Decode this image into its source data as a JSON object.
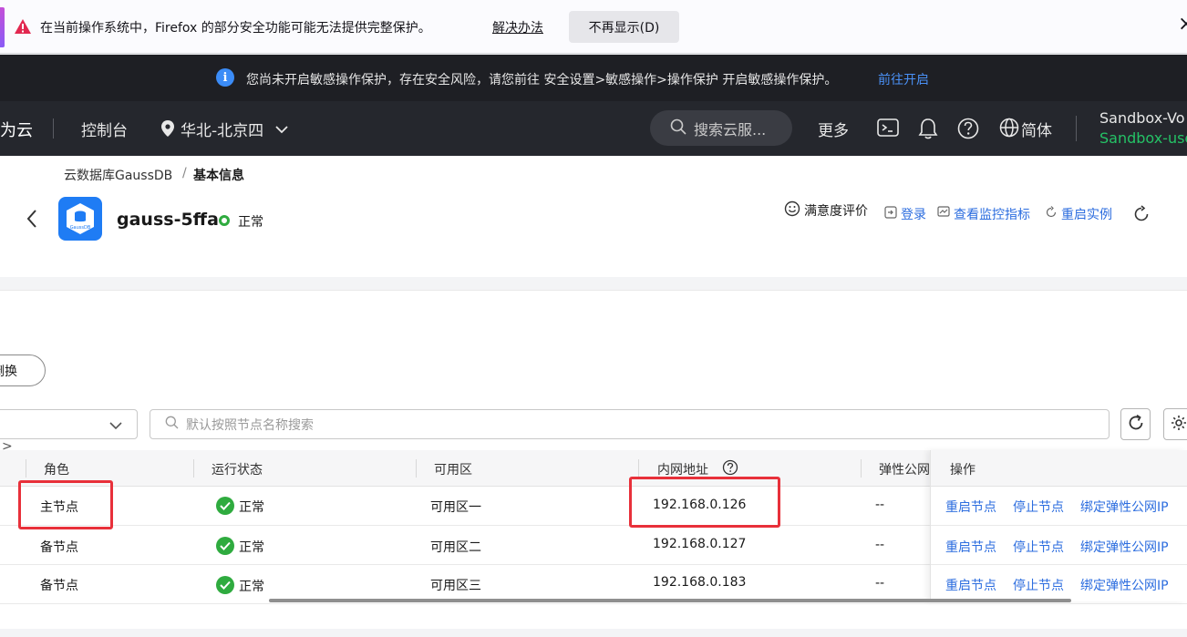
{
  "firefox_bar": {
    "message": "在当前操作系统中，Firefox 的部分安全功能可能无法提供完整保护。",
    "fix_link": "解决办法",
    "dont_show_button": "不再显示(D)",
    "close": "×"
  },
  "notice": {
    "text": "您尚未开启敏感操作保护，存在安全风险，请您前往 安全设置>敏感操作>操作保护 开启敏感操作保护。",
    "link": "前往开启",
    "info_glyph": "i"
  },
  "topnav": {
    "brand": "为云",
    "console": "控制台",
    "region": "华北-北京四",
    "search_placeholder": "搜索云服...",
    "more": "更多",
    "language": "简体",
    "account_line1": "Sandbox-Vo",
    "account_line2": "Sandbox-use"
  },
  "breadcrumb": {
    "parent": "云数据库GaussDB",
    "separator": "/",
    "current": "基本信息"
  },
  "instance": {
    "name": "gauss-5ffa",
    "status": "正常",
    "logo_text": "GaussDB"
  },
  "header_actions": {
    "satisfaction": "满意度评价",
    "login": "登录",
    "monitor": "查看监控指标",
    "restart": "重启实例"
  },
  "toolbar": {
    "switch_button": "倒换",
    "search_placeholder": "默认按照节点名称搜索",
    "expand_glyph": ">"
  },
  "table": {
    "columns": {
      "role": "角色",
      "run_status": "运行状态",
      "az": "可用区",
      "private_ip": "内网地址",
      "eip": "弹性公网",
      "ops": "操作"
    },
    "rows": [
      {
        "role": "主节点",
        "status": "正常",
        "az": "可用区一",
        "ip": "192.168.0.126",
        "eip": "--",
        "op1": "重启节点",
        "op2": "停止节点",
        "op3": "绑定弹性公网IP"
      },
      {
        "role": "备节点",
        "status": "正常",
        "az": "可用区二",
        "ip": "192.168.0.127",
        "eip": "--",
        "op1": "重启节点",
        "op2": "停止节点",
        "op3": "绑定弹性公网IP"
      },
      {
        "role": "备节点",
        "status": "正常",
        "az": "可用区三",
        "ip": "192.168.0.183",
        "eip": "--",
        "op1": "重启节点",
        "op2": "停止节点",
        "op3": "绑定弹性公网IP"
      }
    ]
  },
  "colors": {
    "link": "#2c6ddf",
    "ok_green": "#2fab3f",
    "highlight_red": "#e8303a",
    "nav_bg": "#25272d",
    "account_green": "#25c266"
  }
}
